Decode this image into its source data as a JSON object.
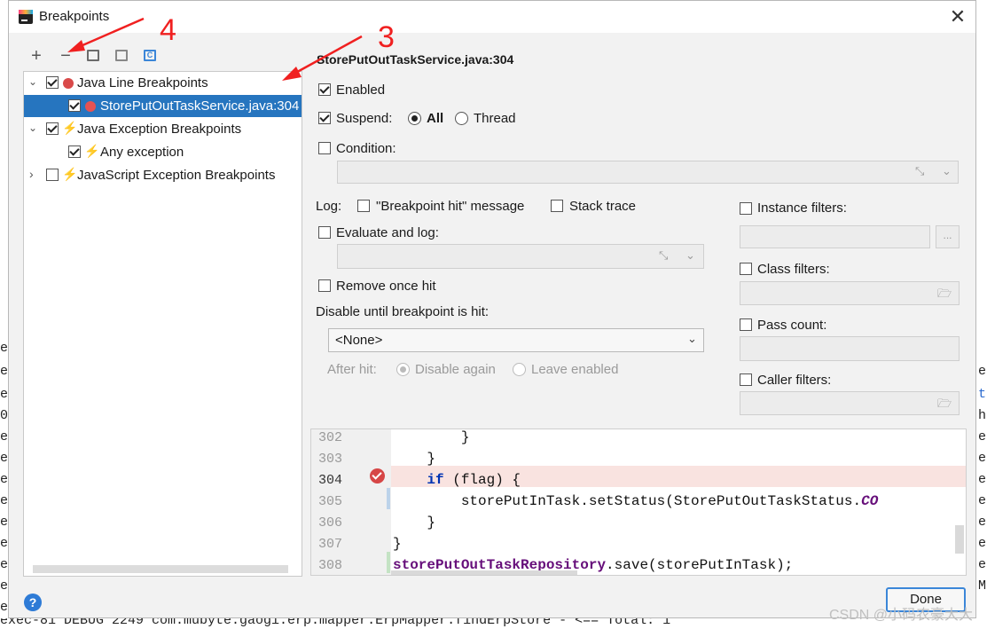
{
  "dialog": {
    "title": "Breakpoints",
    "close": "✕"
  },
  "toolbar": {
    "add": "+",
    "remove": "−",
    "group_label": "C"
  },
  "tree": {
    "items": [
      {
        "label": "Java Line Breakpoints",
        "checked": true,
        "expanded": true
      },
      {
        "label": "StorePutOutTaskService.java:304",
        "checked": true,
        "selected": true
      },
      {
        "label": "Java Exception Breakpoints",
        "checked": true,
        "expanded": true
      },
      {
        "label": "Any exception",
        "checked": true
      },
      {
        "label": "JavaScript Exception Breakpoints",
        "checked": false,
        "expanded": false
      }
    ]
  },
  "details": {
    "header": "StorePutOutTaskService.java:304",
    "enabled_label": "Enabled",
    "suspend_label": "Suspend:",
    "suspend_all": "All",
    "suspend_thread": "Thread",
    "condition_label": "Condition:",
    "log_label": "Log:",
    "log_message": "\"Breakpoint hit\" message",
    "log_stack": "Stack trace",
    "evaluate_label": "Evaluate and log:",
    "remove_once": "Remove once hit",
    "disable_until": "Disable until breakpoint is hit:",
    "disable_value": "<None>",
    "after_hit_label": "After hit:",
    "after_disable": "Disable again",
    "after_leave": "Leave enabled",
    "instance_filters": "Instance filters:",
    "instance_btn": "...",
    "class_filters": "Class filters:",
    "pass_count": "Pass count:",
    "caller_filters": "Caller filters:"
  },
  "code": {
    "lines": [
      {
        "num": "302",
        "text": "        }"
      },
      {
        "num": "303",
        "text": "    }"
      },
      {
        "num": "304",
        "pre": "    ",
        "kw": "if",
        "rest": " (flag) {"
      },
      {
        "num": "305",
        "pre": "        storePutInTask.setStatus(StorePutOutTaskStatus.",
        "cst": "CO"
      },
      {
        "num": "306",
        "text": "    }"
      },
      {
        "num": "307",
        "text": "}"
      },
      {
        "num": "308",
        "fld": "storePutOutTaskRepository",
        "rest": ".save(storePutInTask);"
      }
    ]
  },
  "footer": {
    "help": "?",
    "done": "Done"
  },
  "annotations": {
    "a3": "3",
    "a4": "4"
  },
  "background": {
    "bottom_text": "exec-81 DEBUG 2249  com.mubyte.gaogi.erp.mapper.ErpMapper.findErpStore - <==        Total: 1",
    "watermark": "CSDN @小码农豪大大"
  },
  "colors": {
    "selection": "#2675bf",
    "breakpoint": "#d64646",
    "annotation": "#f02020",
    "done_border": "#3b86d8"
  }
}
